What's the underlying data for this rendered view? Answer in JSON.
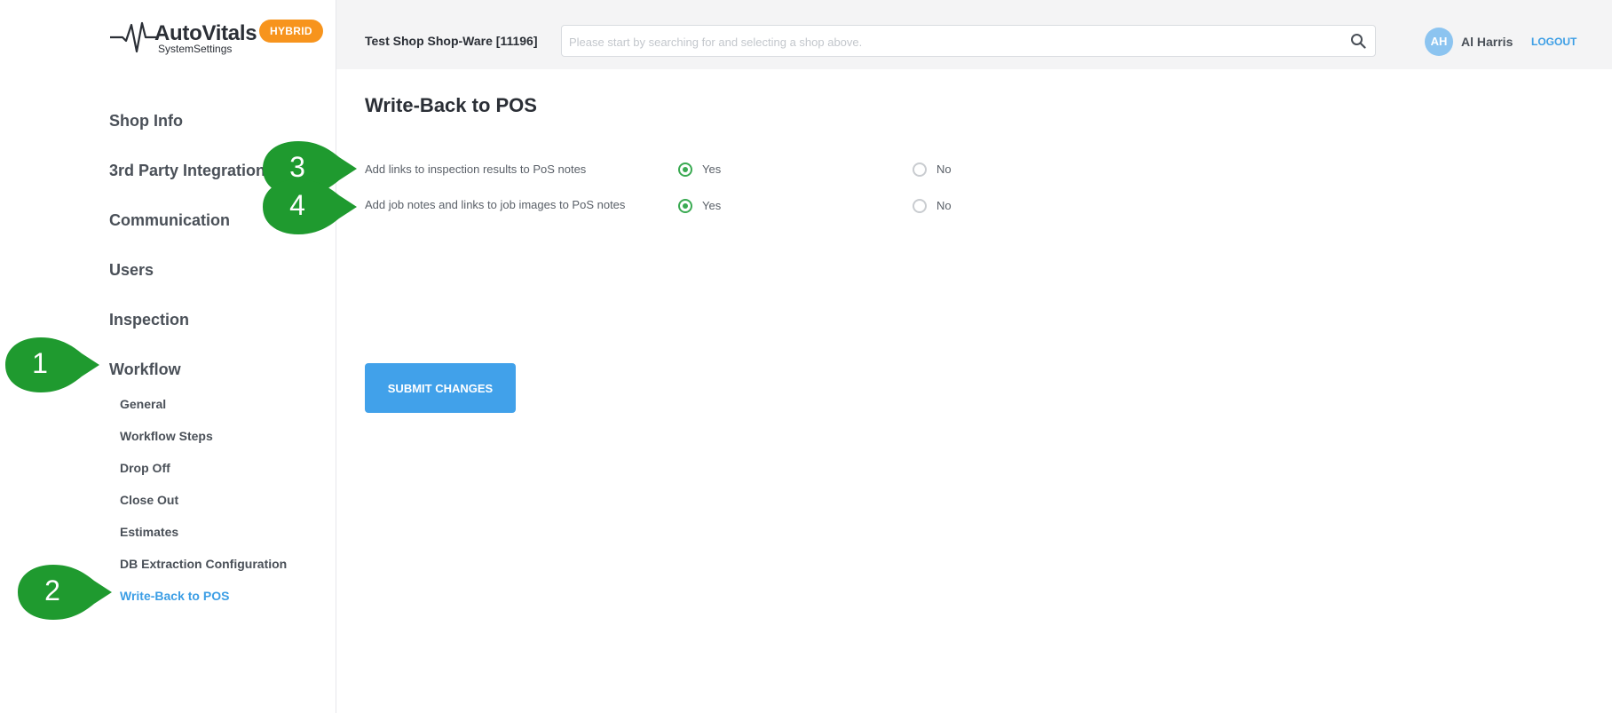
{
  "brand": {
    "name": "AutoVitals",
    "subtitle": "SystemSettings",
    "badge": "HYBRID"
  },
  "sidebar": {
    "items": [
      {
        "label": "Shop Info"
      },
      {
        "label": "3rd Party Integration"
      },
      {
        "label": "Communication"
      },
      {
        "label": "Users"
      },
      {
        "label": "Inspection"
      },
      {
        "label": "Workflow"
      }
    ],
    "workflow_sub": [
      {
        "label": "General"
      },
      {
        "label": "Workflow Steps"
      },
      {
        "label": "Drop Off"
      },
      {
        "label": "Close Out"
      },
      {
        "label": "Estimates"
      },
      {
        "label": "DB Extraction Configuration"
      },
      {
        "label": "Write-Back to POS",
        "active": true
      }
    ]
  },
  "header": {
    "shop_name": "Test Shop Shop-Ware [11196]",
    "search_placeholder": "Please start by searching for and selecting a shop above.",
    "search_icon": "search-icon",
    "avatar_initials": "AH",
    "user_name": "Al Harris",
    "logout": "LOGOUT"
  },
  "main": {
    "title": "Write-Back to POS",
    "settings": [
      {
        "label": "Add links to inspection results to PoS notes",
        "yes": "Yes",
        "no": "No",
        "selected": "Yes"
      },
      {
        "label": "Add job notes and links to job images to PoS notes",
        "yes": "Yes",
        "no": "No",
        "selected": "Yes"
      }
    ],
    "submit_label": "SUBMIT CHANGES"
  },
  "callouts": [
    "1",
    "2",
    "3",
    "4"
  ],
  "colors": {
    "accent": "#41a1ea",
    "active_link": "#3c9ee5",
    "badge": "#f7941d",
    "radio_checked": "#3aaa52",
    "callout": "#1f9a2f"
  }
}
